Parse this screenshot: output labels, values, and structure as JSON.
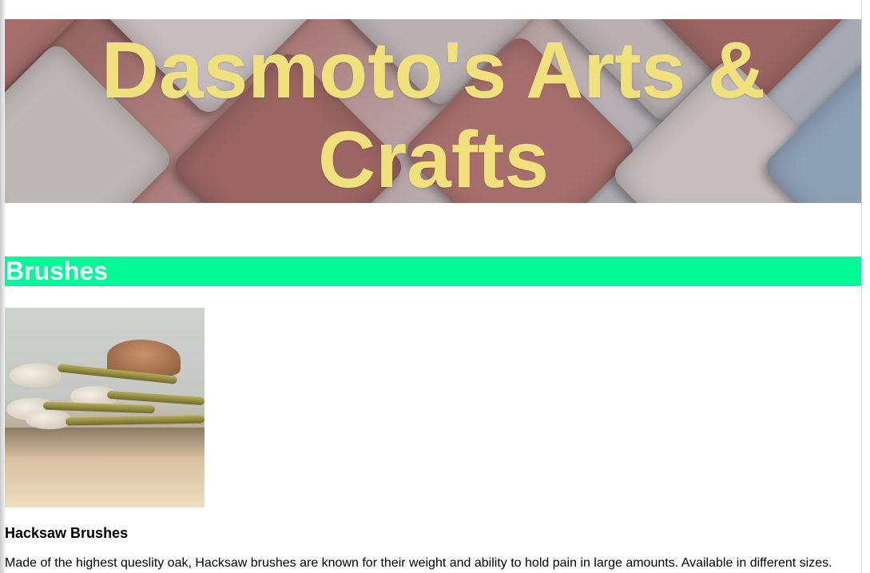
{
  "header": {
    "title": "Dasmoto's Arts & Crafts"
  },
  "sections": [
    {
      "heading": "Brushes",
      "heading_color": "#00f995",
      "item": {
        "image": "brushes-image",
        "name": "Hacksaw Brushes",
        "description": "Made of the highest queslity oak, Hacksaw brushes are known for their weight and ability to hold pain in large amounts. Available in different sizes."
      }
    }
  ],
  "colors": {
    "title": "#f0e17c",
    "heading_text": "#ffffff",
    "body_text": "#000000"
  }
}
